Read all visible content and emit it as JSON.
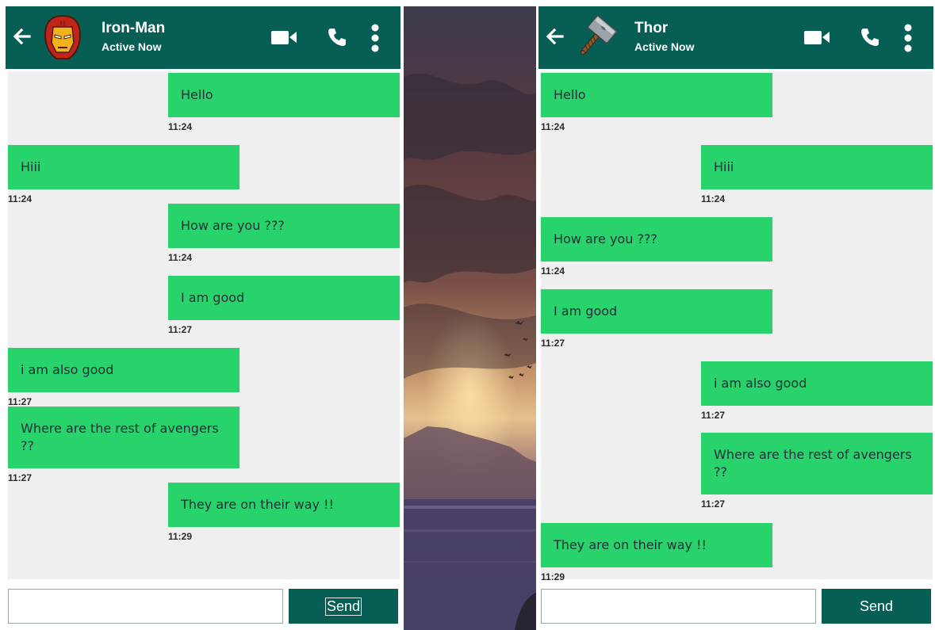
{
  "left_chat": {
    "contact_name": "Iron-Man",
    "status": "Active Now",
    "avatar_icon": "iron-man-helmet-icon",
    "messages": [
      {
        "text": "Hello",
        "time": "11:24",
        "direction": "out"
      },
      {
        "text": "Hiii",
        "time": "11:24",
        "direction": "in"
      },
      {
        "text": "How are you ???",
        "time": "11:24",
        "direction": "out"
      },
      {
        "text": "I am good",
        "time": "11:27",
        "direction": "out"
      },
      {
        "text": "i am also good",
        "time": "11:27",
        "direction": "in"
      },
      {
        "text": "Where are the rest of avengers ??",
        "time": "11:27",
        "direction": "in"
      },
      {
        "text": "They are on their way !!",
        "time": "11:29",
        "direction": "out"
      }
    ],
    "input_value": "",
    "send_label": "Send"
  },
  "right_chat": {
    "contact_name": "Thor",
    "status": "Active Now",
    "avatar_icon": "thor-hammer-icon",
    "messages": [
      {
        "text": "Hello",
        "time": "11:24",
        "direction": "in"
      },
      {
        "text": "Hiii",
        "time": "11:24",
        "direction": "out"
      },
      {
        "text": "How are you ???",
        "time": "11:24",
        "direction": "in"
      },
      {
        "text": "I am good",
        "time": "11:27",
        "direction": "in"
      },
      {
        "text": "i am also good",
        "time": "11:27",
        "direction": "out"
      },
      {
        "text": "Where are the rest of avengers ??",
        "time": "11:27",
        "direction": "out"
      },
      {
        "text": "They are on their way !!",
        "time": "11:29",
        "direction": "in"
      }
    ],
    "input_value": "",
    "send_label": "Send"
  },
  "colors": {
    "header": "#075e54",
    "bubble": "#29d36c",
    "chat_background": "#efefef"
  },
  "icons": [
    "back-arrow-icon",
    "video-call-icon",
    "phone-icon",
    "more-options-icon"
  ]
}
